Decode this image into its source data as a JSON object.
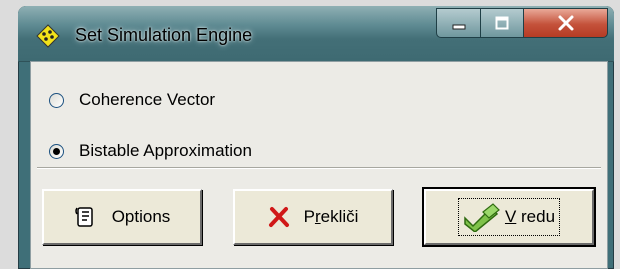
{
  "window": {
    "title": "Set Simulation Engine",
    "icon": "diamond-app-icon",
    "caption_buttons": [
      "minimize-icon",
      "maximize-icon",
      "close-icon"
    ]
  },
  "engine_options": [
    {
      "label": "Coherence Vector",
      "selected": false
    },
    {
      "label": "Bistable Approximation",
      "selected": true
    }
  ],
  "buttons": {
    "options": {
      "label": "Options",
      "icon": "options-icon"
    },
    "cancel": {
      "prefix": "P",
      "underlined": "r",
      "suffix": "ekliči",
      "icon": "red-x-icon"
    },
    "ok": {
      "underlined": "V",
      "suffix": " redu",
      "icon": "check-icon"
    }
  },
  "colors": {
    "titlebar": "#436f77",
    "close_button": "#c4523b",
    "client_bg": "#ecebe6"
  }
}
